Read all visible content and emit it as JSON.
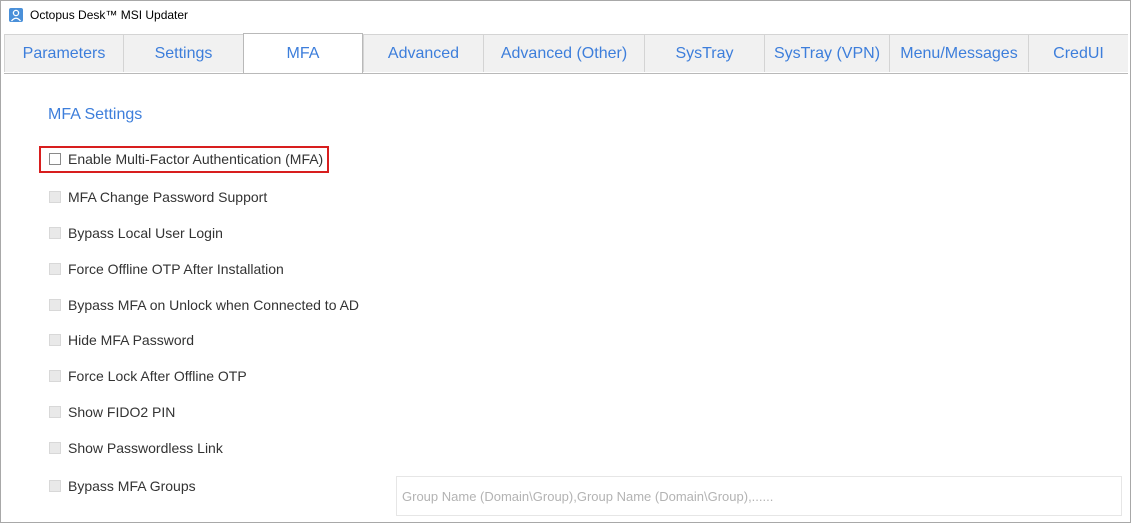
{
  "window": {
    "title": "Octopus Desk™ MSI Updater",
    "icon": "app-person-icon"
  },
  "tabs": [
    {
      "label": "Parameters",
      "active": false
    },
    {
      "label": "Settings",
      "active": false
    },
    {
      "label": "MFA",
      "active": true
    },
    {
      "label": "Advanced",
      "active": false
    },
    {
      "label": "Advanced (Other)",
      "active": false
    },
    {
      "label": "SysTray",
      "active": false
    },
    {
      "label": "SysTray (VPN)",
      "active": false
    },
    {
      "label": "Menu/Messages",
      "active": false
    },
    {
      "label": "CredUI",
      "active": false
    }
  ],
  "mfa": {
    "section_title": "MFA Settings",
    "options": [
      {
        "label": "Enable Multi-Factor Authentication (MFA)",
        "checked": false,
        "enabled": true,
        "highlighted": true
      },
      {
        "label": "MFA Change Password Support",
        "checked": false,
        "enabled": false
      },
      {
        "label": "Bypass Local User Login",
        "checked": false,
        "enabled": false
      },
      {
        "label": "Force Offline OTP After Installation",
        "checked": false,
        "enabled": false
      },
      {
        "label": "Bypass MFA on Unlock when Connected to AD",
        "checked": false,
        "enabled": false
      },
      {
        "label": "Hide MFA Password",
        "checked": false,
        "enabled": false
      },
      {
        "label": "Force Lock After Offline OTP",
        "checked": false,
        "enabled": false
      },
      {
        "label": "Show FIDO2 PIN",
        "checked": false,
        "enabled": false
      },
      {
        "label": "Show Passwordless Link",
        "checked": false,
        "enabled": false
      },
      {
        "label": "Bypass MFA Groups",
        "checked": false,
        "enabled": false
      }
    ],
    "groups_input": {
      "value": "",
      "placeholder": "Group Name (Domain\\Group),Group Name (Domain\\Group),......"
    }
  },
  "colors": {
    "accent": "#3d7edb",
    "highlight_border": "#d81e1e",
    "tab_inactive_bg": "#f1f1f1"
  }
}
